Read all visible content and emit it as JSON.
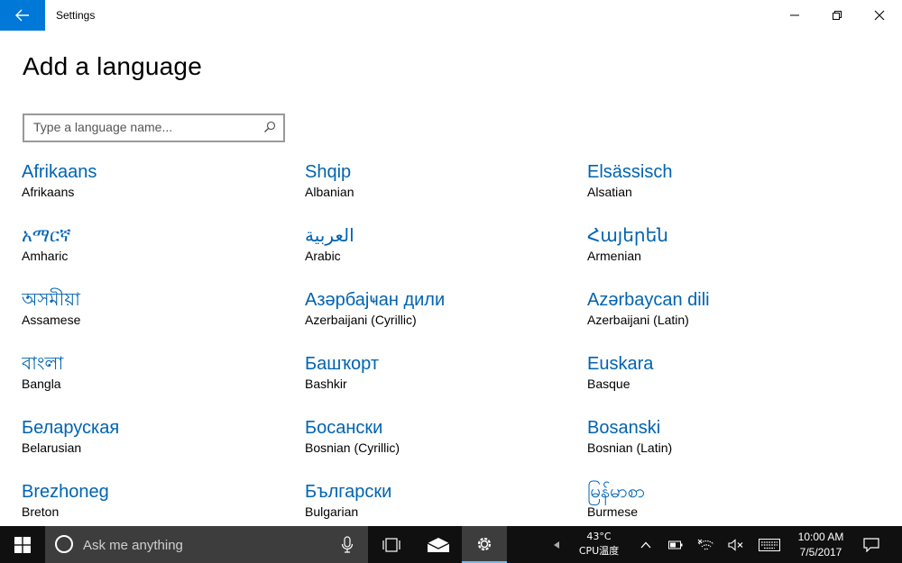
{
  "window": {
    "title": "Settings"
  },
  "page": {
    "title": "Add a language"
  },
  "search": {
    "placeholder": "Type a language name..."
  },
  "languages": [
    {
      "native": "Afrikaans",
      "english": "Afrikaans"
    },
    {
      "native": "Shqip",
      "english": "Albanian"
    },
    {
      "native": "Elsässisch",
      "english": "Alsatian"
    },
    {
      "native": "አማርኛ",
      "english": "Amharic"
    },
    {
      "native": "العربية",
      "english": "Arabic"
    },
    {
      "native": "Հայերեն",
      "english": "Armenian"
    },
    {
      "native": "অসমীয়া",
      "english": "Assamese"
    },
    {
      "native": "Азәрбајҹан дили",
      "english": "Azerbaijani (Cyrillic)"
    },
    {
      "native": "Azərbaycan dili",
      "english": "Azerbaijani (Latin)"
    },
    {
      "native": "বাংলা",
      "english": "Bangla"
    },
    {
      "native": "Башҡорт",
      "english": "Bashkir"
    },
    {
      "native": "Euskara",
      "english": "Basque"
    },
    {
      "native": "Беларуская",
      "english": "Belarusian"
    },
    {
      "native": "Босански",
      "english": "Bosnian (Cyrillic)"
    },
    {
      "native": "Bosanski",
      "english": "Bosnian (Latin)"
    },
    {
      "native": "Brezhoneg",
      "english": "Breton"
    },
    {
      "native": "Български",
      "english": "Bulgarian"
    },
    {
      "native": "မြန်မာစာ",
      "english": "Burmese"
    }
  ],
  "taskbar": {
    "cortana_placeholder": "Ask me anything",
    "temperature": "43°C",
    "cpu_label": "CPU温度",
    "time": "10:00 AM",
    "date": "7/5/2017"
  },
  "colors": {
    "accent": "#0078d7",
    "link": "#0063b1",
    "taskbar": "#101010"
  }
}
